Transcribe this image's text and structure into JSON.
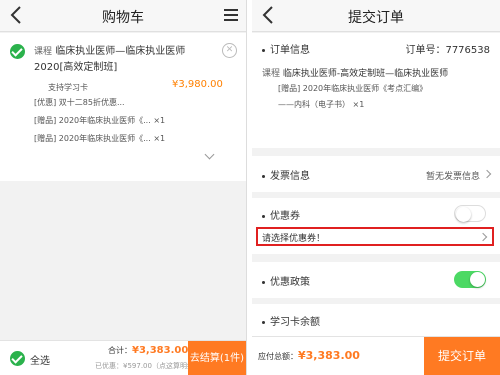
{
  "cart": {
    "title": "购物车",
    "item": {
      "course_tag": "课程",
      "course_title": "临床执业医师—临床执业医师2020[高效定制班]",
      "support": "支持学习卡",
      "price": "¥3,980.00",
      "lines": [
        "[优惠] 双十二85折优惠...",
        "[赠品] 2020年临床执业医师《...    ×1",
        "[赠品] 2020年临床执业医师《...    ×1"
      ]
    },
    "bottom": {
      "select_all": "全选",
      "total_label": "合计：",
      "total": "¥3,383.00",
      "discount_label": "已优惠：¥597.00（点这算明细）",
      "checkout": "去结算(1件)"
    }
  },
  "order": {
    "title": "提交订单",
    "info_label": "订单信息",
    "order_no": "订单号：7776538",
    "course_tag": "课程",
    "course_title": "临床执业医师-高效定制班—临床执业医师",
    "gift_line1": "[赠品] 2020年临床执业医师《考点汇编》",
    "gift_line2": "——内科（电子书）    ×1",
    "invoice_label": "发票信息",
    "invoice_value": "暂无发票信息",
    "coupon_label": "优惠券",
    "coupon_select": "请选择优惠券！",
    "policy_label": "优惠政策",
    "card_label": "学习卡余额",
    "total_label": "应付总额：",
    "total": "¥3,383.00",
    "submit": "提交订单"
  },
  "colors": {
    "accent": "#ff7a22",
    "green": "#2bb24c",
    "toggle_on": "#4cd964",
    "highlight": "#e02020"
  },
  "icons": [
    "back-chevron-icon",
    "menu-icon",
    "check-icon",
    "close-circle-icon",
    "chevron-down-icon",
    "chevron-right-icon"
  ]
}
